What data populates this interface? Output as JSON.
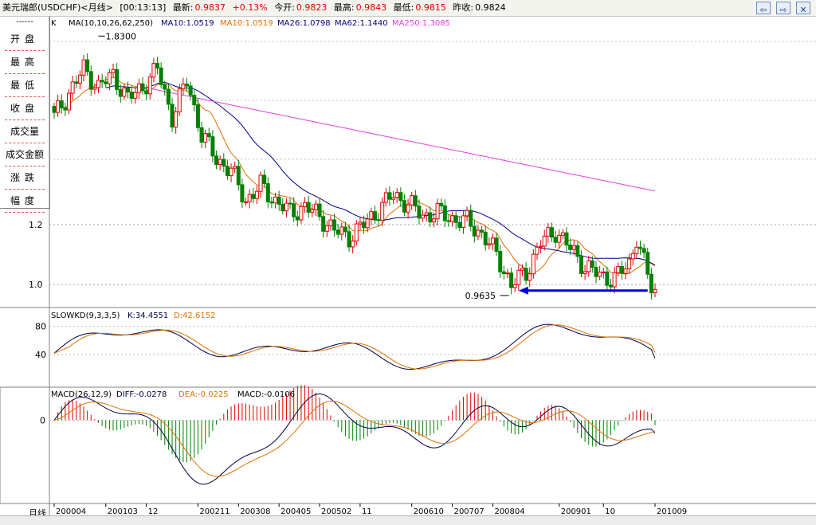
{
  "titlebar": {
    "name": "美元瑞郎(USDCHF)<月线>",
    "time": "[00:13:13]",
    "latest_label": "最新:",
    "latest_value": "0.9837",
    "change": "+0.13%",
    "open_label": "今开:",
    "open_value": "0.9823",
    "high_label": "最高:",
    "high_value": "0.9843",
    "low_label": "最低:",
    "low_value": "0.9815",
    "prev_label": "昨收:",
    "prev_value": "0.9824"
  },
  "sidebar": {
    "separator": "------",
    "items": [
      "开盘",
      "最高",
      "最低",
      "收盘",
      "成交量",
      "成交金额",
      "涨跌",
      "幅度"
    ]
  },
  "price_panel": {
    "k_label": "K",
    "ma_label": "MA(10,10,26,62,250)",
    "ma_items": [
      {
        "text": "MA10:1.0519",
        "color": "#000080"
      },
      {
        "text": "MA10:1.0519",
        "color": "#e07000"
      },
      {
        "text": "MA26:1.0798",
        "color": "#000080"
      },
      {
        "text": "MA62:1.1440",
        "color": "#000080"
      },
      {
        "text": "MA250:1.3085",
        "color": "#e040e0"
      }
    ],
    "high_marker": "1.8300",
    "low_marker": "0.9635",
    "y_ticks": [
      "1.2",
      "1.0"
    ]
  },
  "kd_panel": {
    "label": "SLOWKD(9,3,3,5)",
    "k_text": "K:34.4551",
    "d_text": "D:42.6152",
    "y_ticks": [
      "80",
      "40"
    ]
  },
  "macd_panel": {
    "label": "MACD(26,12,9)",
    "diff_text": "DIFF:-0.0278",
    "dea_text": "DEA:-0.0225",
    "macd_text": "MACD:-0.0106",
    "y_ticks": [
      "0"
    ]
  },
  "x_axis": {
    "period_label": "月线",
    "labels": [
      "200004",
      "200103",
      "12",
      "200211",
      "200308",
      "200405",
      "200502",
      "11",
      "200610",
      "200707",
      "200804",
      "200901",
      "10",
      "201009"
    ]
  },
  "colors": {
    "up": "#e00000",
    "down": "#008000",
    "ma_fast": "#e07000",
    "ma_mid": "#000080",
    "ma_long": "#e040e0",
    "arrow": "#0000e0",
    "k_line": "#000040",
    "d_line": "#e07000"
  },
  "chart_data": {
    "type": "candlestick",
    "series": [
      {
        "name": "MA10"
      },
      {
        "name": "MA26"
      },
      {
        "name": "MA62"
      },
      {
        "name": "MA250"
      }
    ],
    "price_anchors": [
      {
        "i": 0,
        "c": 1.56
      },
      {
        "i": 4,
        "c": 1.64
      },
      {
        "i": 8,
        "c": 1.72
      },
      {
        "i": 12,
        "c": 1.66
      },
      {
        "i": 16,
        "c": 1.7
      },
      {
        "i": 20,
        "c": 1.62
      },
      {
        "i": 24,
        "c": 1.66
      },
      {
        "i": 28,
        "c": 1.72
      },
      {
        "i": 32,
        "c": 1.56
      },
      {
        "i": 36,
        "c": 1.68
      },
      {
        "i": 40,
        "c": 1.5
      },
      {
        "i": 44,
        "c": 1.42
      },
      {
        "i": 48,
        "c": 1.38
      },
      {
        "i": 52,
        "c": 1.28
      },
      {
        "i": 56,
        "c": 1.33
      },
      {
        "i": 60,
        "c": 1.28
      },
      {
        "i": 64,
        "c": 1.24
      },
      {
        "i": 68,
        "c": 1.26
      },
      {
        "i": 72,
        "c": 1.23
      },
      {
        "i": 76,
        "c": 1.18
      },
      {
        "i": 80,
        "c": 1.16
      },
      {
        "i": 84,
        "c": 1.2
      },
      {
        "i": 88,
        "c": 1.25
      },
      {
        "i": 92,
        "c": 1.3
      },
      {
        "i": 96,
        "c": 1.27
      },
      {
        "i": 100,
        "c": 1.23
      },
      {
        "i": 104,
        "c": 1.24
      },
      {
        "i": 108,
        "c": 1.22
      },
      {
        "i": 112,
        "c": 1.21
      },
      {
        "i": 116,
        "c": 1.17
      },
      {
        "i": 120,
        "c": 1.1
      },
      {
        "i": 124,
        "c": 1.0
      },
      {
        "i": 128,
        "c": 1.04
      },
      {
        "i": 132,
        "c": 1.14
      },
      {
        "i": 136,
        "c": 1.18
      },
      {
        "i": 140,
        "c": 1.12
      },
      {
        "i": 144,
        "c": 1.06
      },
      {
        "i": 148,
        "c": 1.03
      },
      {
        "i": 152,
        "c": 1.02
      },
      {
        "i": 156,
        "c": 1.07
      },
      {
        "i": 158,
        "c": 1.16
      },
      {
        "i": 160,
        "c": 1.07
      },
      {
        "i": 162,
        "c": 0.99
      },
      {
        "i": 163,
        "c": 0.98
      }
    ],
    "bars": 164,
    "y_range": [
      0.95,
      1.86
    ],
    "high": 1.83,
    "low": 0.9635,
    "kd_y_range": [
      0,
      100
    ],
    "macd_y_range": [
      -0.17,
      0.06
    ]
  }
}
